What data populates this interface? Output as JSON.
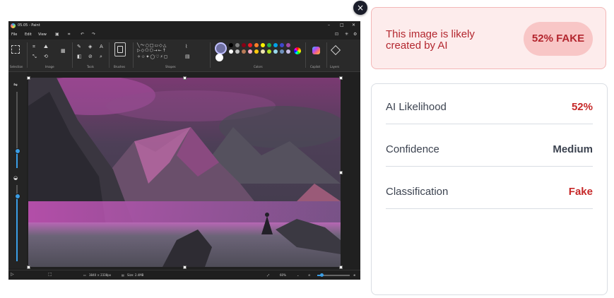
{
  "close_button": {
    "glyph": "×"
  },
  "paint": {
    "window_title": "05.05 - Paint",
    "menu": [
      "File",
      "Edit",
      "View"
    ],
    "ribbon_groups": [
      "Selection",
      "Image",
      "Tools",
      "Brushes",
      "Shapes",
      "Colors",
      "Copilot",
      "Layers"
    ],
    "palette": [
      "#000000",
      "#7f7f7f",
      "#880015",
      "#ed1c24",
      "#ff7f27",
      "#fff200",
      "#22b14c",
      "#00a2e8",
      "#3f48cc",
      "#a349a4",
      "#ffffff",
      "#c3c3c3",
      "#b97a57",
      "#ffaec9",
      "#ffc90e",
      "#efe4b0",
      "#b5e61d",
      "#99d9ea",
      "#7092be",
      "#c8bfe7"
    ],
    "status": {
      "dimensions": "3840 × 2338px",
      "size": "Size: 2.4MB",
      "zoom": "60%"
    },
    "zoom_slider_fraction": 0.12
  },
  "result": {
    "verdict_text": "This image is likely created by AI",
    "badge": "52% FAKE",
    "accent_color": "#c62828",
    "rows": [
      {
        "label": "AI Likelihood",
        "value": "52%"
      },
      {
        "label": "Confidence",
        "value": "Medium"
      },
      {
        "label": "Classification",
        "value": "Fake"
      }
    ]
  }
}
